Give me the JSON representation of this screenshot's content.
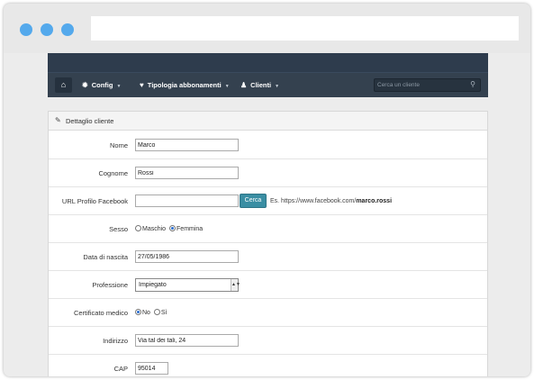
{
  "navbar": {
    "home_icon": "home-icon",
    "items": [
      {
        "label": "Config",
        "icon": "gear-icon"
      },
      {
        "label": "Tipologia abbonamenti",
        "icon": "heart-icon"
      },
      {
        "label": "Clienti",
        "icon": "user-icon"
      }
    ],
    "search": {
      "placeholder": "Cerca un cliente"
    }
  },
  "panel": {
    "title": "Dettaglio cliente",
    "fields": {
      "nome": {
        "label": "Nome",
        "value": "Marco"
      },
      "cognome": {
        "label": "Cognome",
        "value": "Rossi"
      },
      "facebook": {
        "label": "URL Profilo Facebook",
        "value": "",
        "button": "Cerca",
        "hint_prefix": "Es. https://www.facebook.com/",
        "hint_bold": "marco.rossi"
      },
      "sesso": {
        "label": "Sesso",
        "options": [
          "Maschio",
          "Femmina"
        ],
        "selected": "Femmina"
      },
      "nascita": {
        "label": "Data di nascita",
        "value": "27/05/1986"
      },
      "professione": {
        "label": "Professione",
        "value": "Impiegato"
      },
      "certificato": {
        "label": "Certificato medico",
        "options": [
          "No",
          "Sì"
        ],
        "selected": "No"
      },
      "indirizzo": {
        "label": "Indirizzo",
        "value": "Via tal dei tali, 24"
      },
      "cap": {
        "label": "CAP",
        "value": "95014"
      }
    }
  },
  "colors": {
    "accent": "#54a9ec",
    "navbar": "#34414f",
    "button": "#3a8ea3"
  }
}
